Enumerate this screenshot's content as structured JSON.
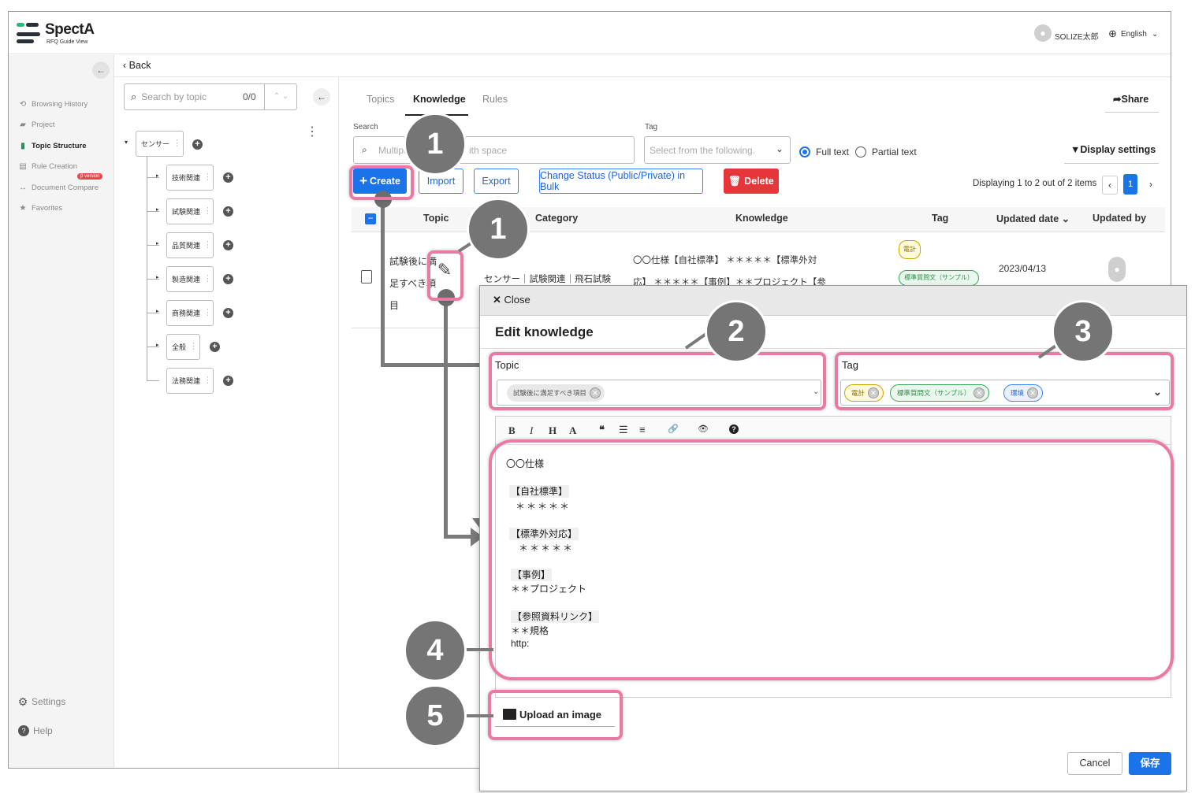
{
  "app": {
    "name": "SpectA",
    "sub": "RFQ Guide View"
  },
  "header": {
    "user": "SOLIZE太郎",
    "language": "English"
  },
  "sidebar": {
    "items": [
      {
        "label": "Browsing History",
        "icon": "history-icon"
      },
      {
        "label": "Project",
        "icon": "briefcase-icon"
      },
      {
        "label": "Topic Structure",
        "icon": "clipboard-icon",
        "active": true
      },
      {
        "label": "Rule Creation",
        "icon": "document-icon"
      },
      {
        "label": "Document Compare",
        "icon": "compare-icon"
      },
      {
        "label": "Favorites",
        "icon": "star-icon"
      }
    ],
    "beta_badge": "β version",
    "settings": "Settings",
    "help": "Help"
  },
  "back": "Back",
  "tree": {
    "search_placeholder": "Search by topic",
    "count": "0/0",
    "root": "センサー",
    "children": [
      "技術関連",
      "試験関連",
      "品質関連",
      "製造関連",
      "商務関連",
      "全般",
      "法務関連"
    ]
  },
  "tabs": [
    "Topics",
    "Knowledge",
    "Rules"
  ],
  "share": "Share",
  "filters": {
    "search_label": "Search",
    "search_placeholder_a": "Multipl",
    "search_placeholder_b": "ith space",
    "tag_label": "Tag",
    "tag_placeholder": "Select from the following.",
    "full_text": "Full text",
    "partial_text": "Partial text",
    "display_settings": "Display settings"
  },
  "toolbar": {
    "create": "Create",
    "import": "Import",
    "export": "Export",
    "bulk": "Change Status (Public/Private) in Bulk",
    "delete": "Delete",
    "displaying": "Displaying 1 to 2 out of 2 items",
    "page": "1"
  },
  "table": {
    "headers": [
      "Topic",
      "Category",
      "Knowledge",
      "Tag",
      "Updated date",
      "Updated by"
    ],
    "row": {
      "topic": [
        "試験後に満",
        "足すべき項",
        "目"
      ],
      "category": "センサー｜試験関連｜飛石試験",
      "knowledge": [
        "〇〇仕様【自社標準】 ＊＊＊＊＊【標準外対",
        "応】 ＊＊＊＊＊【事例】＊＊プロジェクト【参"
      ],
      "tags": [
        "電計",
        "標準質問文（サンプル）"
      ],
      "date": "2023/04/13"
    }
  },
  "modal": {
    "close": "Close",
    "title": "Edit knowledge",
    "topic_label": "Topic",
    "topic_chip": "試験後に満足すべき項目",
    "tag_label": "Tag",
    "tag_chips": [
      "電計",
      "標準質問文（サンプル）",
      "環境"
    ],
    "toolbar": [
      "B",
      "I",
      "H",
      "A",
      "❝",
      "☰",
      "≡",
      "🔗",
      "👁",
      "?"
    ],
    "content": [
      "〇〇仕様",
      "【自社標準】",
      "＊＊＊＊＊",
      "【標準外対応】",
      "＊＊＊＊＊",
      "【事例】",
      "＊＊プロジェクト",
      "【参照資料リンク】",
      "＊＊規格",
      "http:"
    ],
    "upload": "Upload an image",
    "cancel": "Cancel",
    "save": "保存"
  },
  "callouts": [
    "1",
    "1",
    "2",
    "3",
    "4",
    "5"
  ]
}
